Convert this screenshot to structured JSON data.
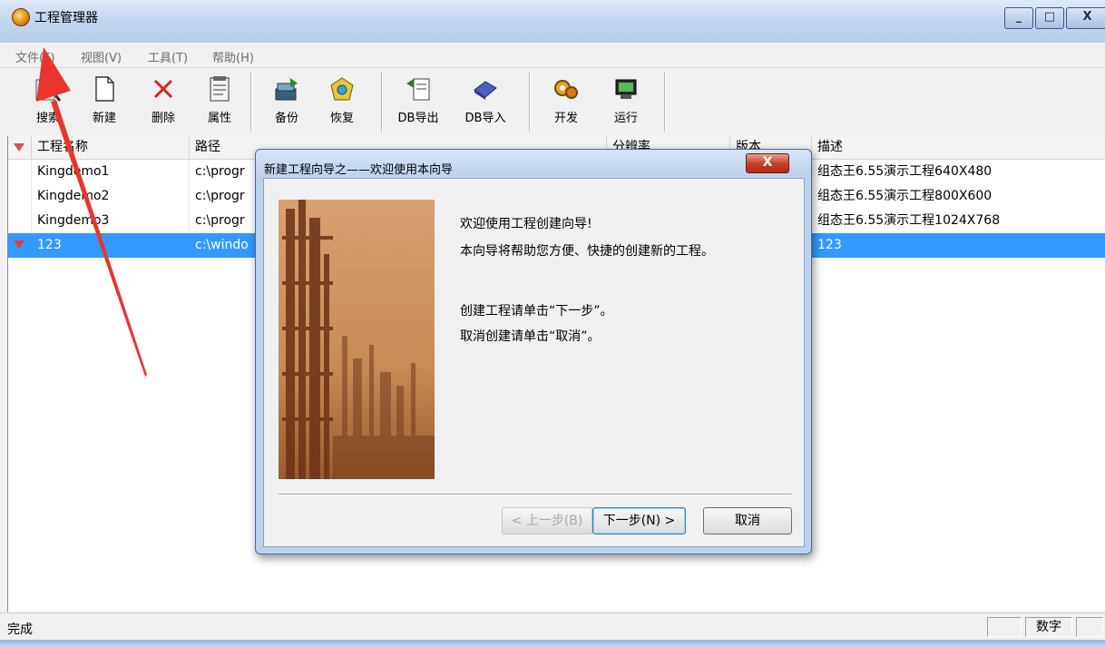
{
  "window": {
    "title": "工程管理器"
  },
  "menu": [
    "文件(F)",
    "视图(V)",
    "工具(T)",
    "帮助(H)"
  ],
  "toolbar": [
    {
      "label": "搜索",
      "icon": "search-icon"
    },
    {
      "label": "新建",
      "icon": "new-file-icon"
    },
    {
      "label": "删除",
      "icon": "delete-icon"
    },
    {
      "label": "属性",
      "icon": "properties-icon"
    },
    {
      "label": "备份",
      "icon": "backup-icon"
    },
    {
      "label": "恢复",
      "icon": "restore-icon"
    },
    {
      "label": "DB导出",
      "icon": "db-export-icon"
    },
    {
      "label": "DB导入",
      "icon": "db-import-icon"
    },
    {
      "label": "开发",
      "icon": "develop-icon"
    },
    {
      "label": "运行",
      "icon": "run-icon"
    }
  ],
  "table": {
    "columns": [
      "工程名称",
      "路径",
      "分辨率",
      "版本",
      "描述"
    ],
    "rows": [
      {
        "name": "Kingdemo1",
        "path": "c:\\progr",
        "desc": "组态王6.55演示工程640X480",
        "flag": false,
        "selected": false
      },
      {
        "name": "Kingdemo2",
        "path": "c:\\progr",
        "desc": "组态王6.55演示工程800X600",
        "flag": false,
        "selected": false
      },
      {
        "name": "Kingdemo3",
        "path": "c:\\progr",
        "desc": "组态王6.55演示工程1024X768",
        "flag": false,
        "selected": false
      },
      {
        "name": "123",
        "path": "c:\\windo",
        "desc": "123",
        "flag": true,
        "selected": true
      }
    ]
  },
  "status": {
    "text": "完成",
    "num_lock": "数字"
  },
  "dialog": {
    "title": "新建工程向导之——欢迎使用本向导",
    "close": "X",
    "lines": [
      "欢迎使用工程创建向导!",
      "本向导将帮助您方便、快捷的创建新的工程。",
      "创建工程请单击“下一步”。",
      "取消创建请单击“取消”。"
    ],
    "buttons": {
      "back": "< 上一步(B)",
      "next": "下一步(N) >",
      "cancel": "取消"
    }
  },
  "colors": {
    "selection": "#3399ff",
    "annotation_arrow": "#e8362e"
  }
}
